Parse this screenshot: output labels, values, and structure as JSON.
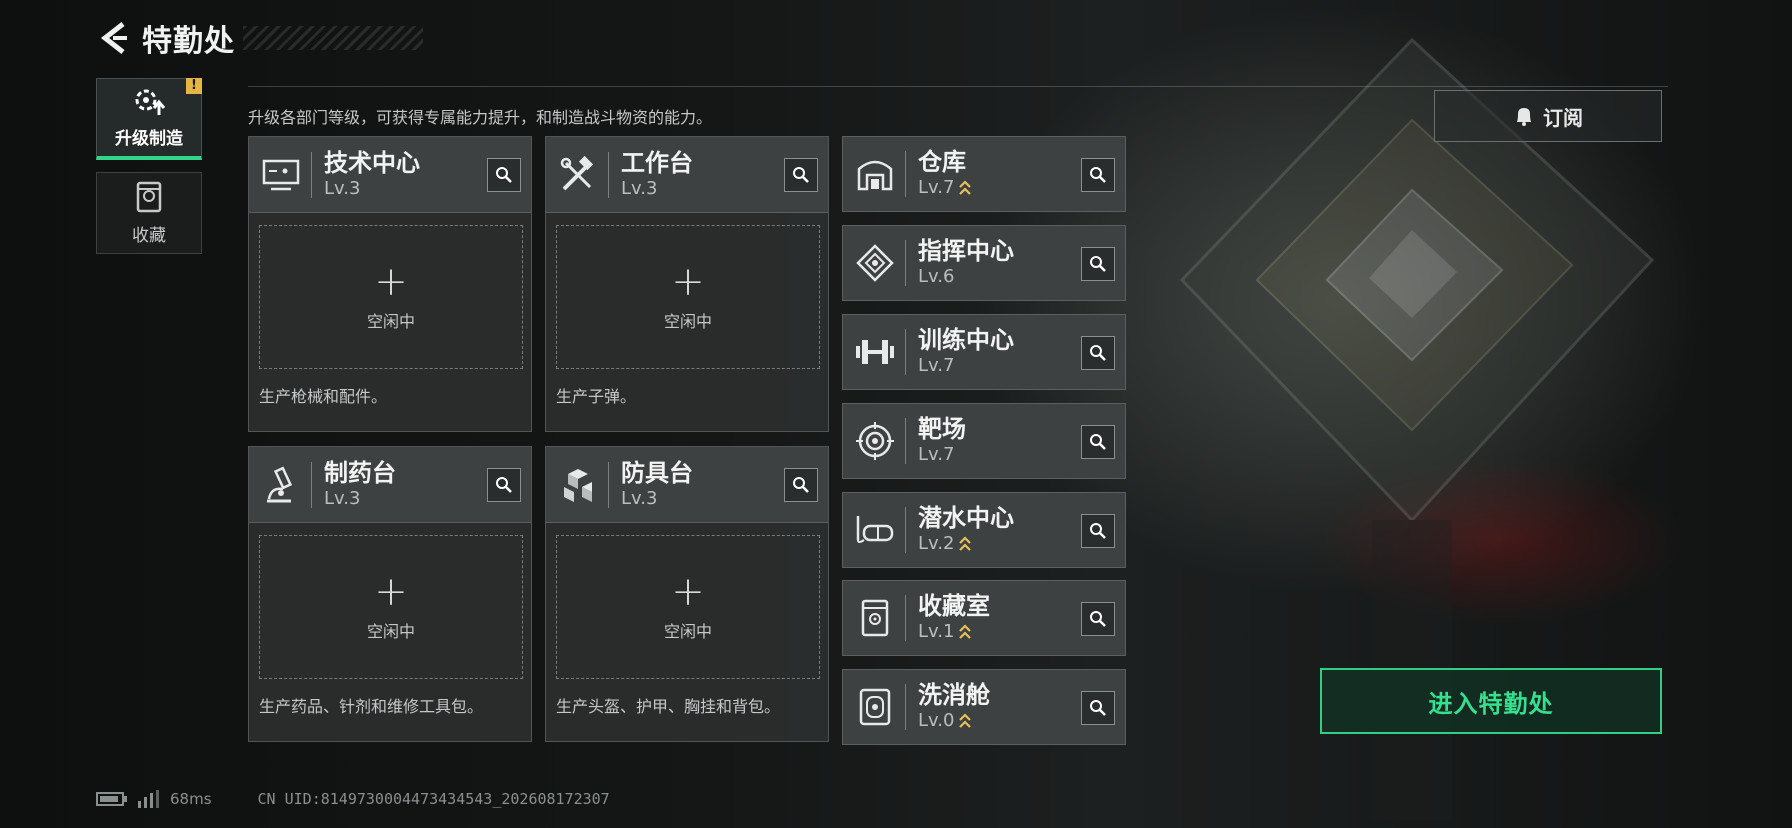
{
  "header": {
    "title": "特勤处"
  },
  "sidebar": {
    "items": [
      {
        "label": "升级制造",
        "active": true,
        "badge": "!"
      },
      {
        "label": "收藏",
        "active": false
      }
    ]
  },
  "description": "升级各部门等级，可获得专属能力提升，和制造战斗物资的能力。",
  "production": [
    {
      "name": "技术中心",
      "level": "Lv.3",
      "slot_status": "空闲中",
      "desc": "生产枪械和配件。",
      "icon": "computer-icon"
    },
    {
      "name": "工作台",
      "level": "Lv.3",
      "slot_status": "空闲中",
      "desc": "生产子弹。",
      "icon": "tools-icon"
    },
    {
      "name": "制药台",
      "level": "Lv.3",
      "slot_status": "空闲中",
      "desc": "生产药品、针剂和维修工具包。",
      "icon": "microscope-icon"
    },
    {
      "name": "防具台",
      "level": "Lv.3",
      "slot_status": "空闲中",
      "desc": "生产头盔、护甲、胸挂和背包。",
      "icon": "armor-blocks-icon"
    }
  ],
  "facilities": [
    {
      "name": "仓库",
      "level": "Lv.7",
      "upgradable": true,
      "icon": "warehouse-icon"
    },
    {
      "name": "指挥中心",
      "level": "Lv.6",
      "upgradable": false,
      "icon": "command-chip-icon"
    },
    {
      "name": "训练中心",
      "level": "Lv.7",
      "upgradable": false,
      "icon": "dumbbell-icon"
    },
    {
      "name": "靶场",
      "level": "Lv.7",
      "upgradable": false,
      "icon": "target-icon"
    },
    {
      "name": "潜水中心",
      "level": "Lv.2",
      "upgradable": true,
      "icon": "diving-mask-icon"
    },
    {
      "name": "收藏室",
      "level": "Lv.1",
      "upgradable": true,
      "icon": "collection-case-icon"
    },
    {
      "name": "洗消舱",
      "level": "Lv.0",
      "upgradable": true,
      "icon": "decon-pod-icon"
    }
  ],
  "subscribe": {
    "label": "订阅"
  },
  "enter_button": {
    "label": "进入特勤处"
  },
  "footer": {
    "ping": "68ms",
    "uid": "CN UID:8149730004473434543_202608172307"
  },
  "colors": {
    "accent_green": "#34d38a",
    "upgrade_gold": "#e6c15a",
    "badge_yellow": "#e6b645"
  }
}
